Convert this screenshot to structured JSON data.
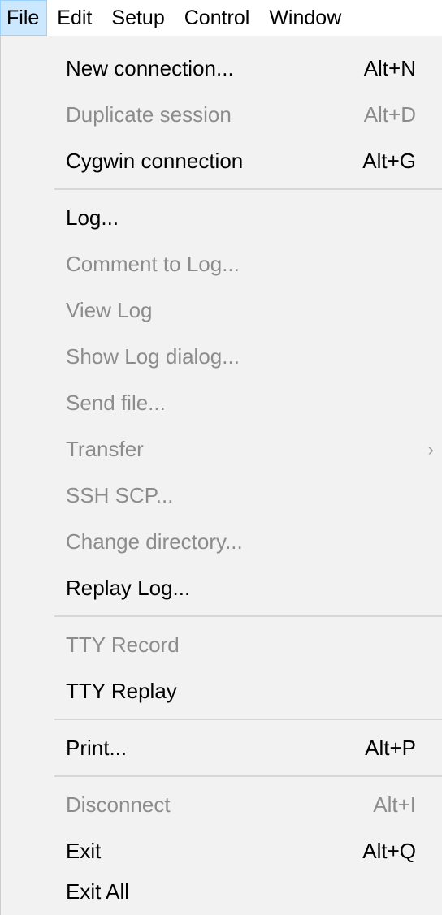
{
  "menubar": {
    "items": [
      {
        "label": "File"
      },
      {
        "label": "Edit"
      },
      {
        "label": "Setup"
      },
      {
        "label": "Control"
      },
      {
        "label": "Window"
      }
    ]
  },
  "file_menu": {
    "new_connection": {
      "label": "New connection...",
      "shortcut": "Alt+N"
    },
    "duplicate_session": {
      "label": "Duplicate session",
      "shortcut": "Alt+D"
    },
    "cygwin_connection": {
      "label": "Cygwin connection",
      "shortcut": "Alt+G"
    },
    "log": {
      "label": "Log..."
    },
    "comment_to_log": {
      "label": "Comment to Log..."
    },
    "view_log": {
      "label": "View Log"
    },
    "show_log_dialog": {
      "label": "Show Log dialog..."
    },
    "send_file": {
      "label": "Send file..."
    },
    "transfer": {
      "label": "Transfer",
      "arrow": "›"
    },
    "ssh_scp": {
      "label": "SSH SCP..."
    },
    "change_directory": {
      "label": "Change directory..."
    },
    "replay_log": {
      "label": "Replay Log..."
    },
    "tty_record": {
      "label": "TTY Record"
    },
    "tty_replay": {
      "label": "TTY Replay"
    },
    "print": {
      "label": "Print...",
      "shortcut": "Alt+P"
    },
    "disconnect": {
      "label": "Disconnect",
      "shortcut": "Alt+I"
    },
    "exit": {
      "label": "Exit",
      "shortcut": "Alt+Q"
    },
    "exit_all": {
      "label": "Exit All"
    }
  },
  "colors": {
    "menu_background": "#f2f2f2",
    "active_highlight": "#cce8ff",
    "disabled_text": "#8c8c8c",
    "separator": "#d7d7d7"
  }
}
